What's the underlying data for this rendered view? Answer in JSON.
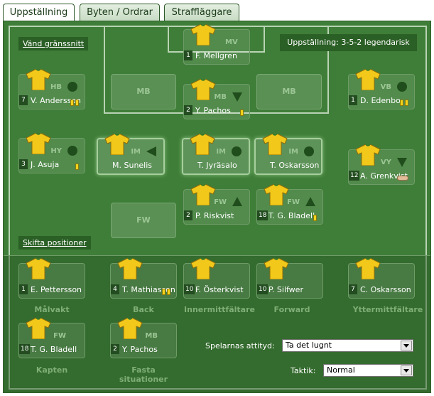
{
  "tabs": [
    {
      "label": "Uppställning"
    },
    {
      "label": "Byten / Ordrar"
    },
    {
      "label": "Straffläggare"
    }
  ],
  "flip_link": "Vänd gränssnitt",
  "formation_label": "Uppställning: 3-5-2 legendarisk",
  "switch_positions_link": "Skifta positioner",
  "players": [
    {
      "id": "mv",
      "pos": "MV",
      "num": "1",
      "name": "F. Mellgren",
      "arrow": "",
      "cards": 0
    },
    {
      "id": "hb",
      "pos": "HB",
      "num": "7",
      "name": "V. Andersson",
      "arrow": "circle",
      "cards": 2
    },
    {
      "id": "mb",
      "pos": "MB",
      "num": "2",
      "name": "Y. Pachos",
      "arrow": "down",
      "cards": 1
    },
    {
      "id": "vb",
      "pos": "VB",
      "num": "1",
      "name": "D. Edenbo",
      "arrow": "circle",
      "cards": 2
    },
    {
      "id": "hy",
      "pos": "HY",
      "num": "3",
      "name": "J. Asuja",
      "arrow": "circle",
      "cards": 1
    },
    {
      "id": "im1",
      "pos": "IM",
      "num": "",
      "name": "M. Sunelis",
      "arrow": "left",
      "cards": 0
    },
    {
      "id": "im2",
      "pos": "IM",
      "num": "",
      "name": "T. Jyräsalo",
      "arrow": "circle",
      "cards": 0
    },
    {
      "id": "im3",
      "pos": "IM",
      "num": "",
      "name": "T. Oskarsson",
      "arrow": "circle",
      "cards": 0
    },
    {
      "id": "vy",
      "pos": "VY",
      "num": "12",
      "name": "A. Grenkvist",
      "arrow": "down",
      "cards": 0
    },
    {
      "id": "fw1",
      "pos": "FW",
      "num": "2",
      "name": "P. Riskvist",
      "arrow": "up",
      "cards": 0
    },
    {
      "id": "fw2",
      "pos": "FW",
      "num": "18",
      "name": "T. G. Bladell",
      "arrow": "up",
      "cards": 1
    }
  ],
  "empty_slots": [
    "MB",
    "MB",
    "FW"
  ],
  "bench": [
    {
      "id": "b1",
      "num": "1",
      "name": "E. Pettersson",
      "role": "Målvakt",
      "cards": 0
    },
    {
      "id": "b2",
      "num": "4",
      "name": "T. Mathiasson",
      "role": "Back",
      "cards": 2
    },
    {
      "id": "b3",
      "num": "10",
      "name": "F. Österkvist",
      "role": "Innermittfältare",
      "cards": 0
    },
    {
      "id": "b4",
      "num": "10",
      "name": "P. Silfwer",
      "role": "Forward",
      "cards": 0
    },
    {
      "id": "b5",
      "num": "7",
      "name": "C. Oskarsson",
      "role": "Yttermittfältare",
      "cards": 0
    }
  ],
  "captain": {
    "pos": "FW",
    "num": "18",
    "name": "T. G. Bladell",
    "role": "Kapten"
  },
  "setpieces": {
    "pos": "MB",
    "num": "2",
    "name": "Y. Pachos",
    "role_line1": "Fasta",
    "role_line2": "situationer"
  },
  "attitude": {
    "label": "Spelarnas attityd:",
    "value": "Ta det lugnt"
  },
  "tactic": {
    "label": "Taktik:",
    "value": "Normal"
  },
  "colors": {
    "field": "#3f7e38",
    "shirt": "#f2c81a",
    "card": "#f2d21a"
  }
}
